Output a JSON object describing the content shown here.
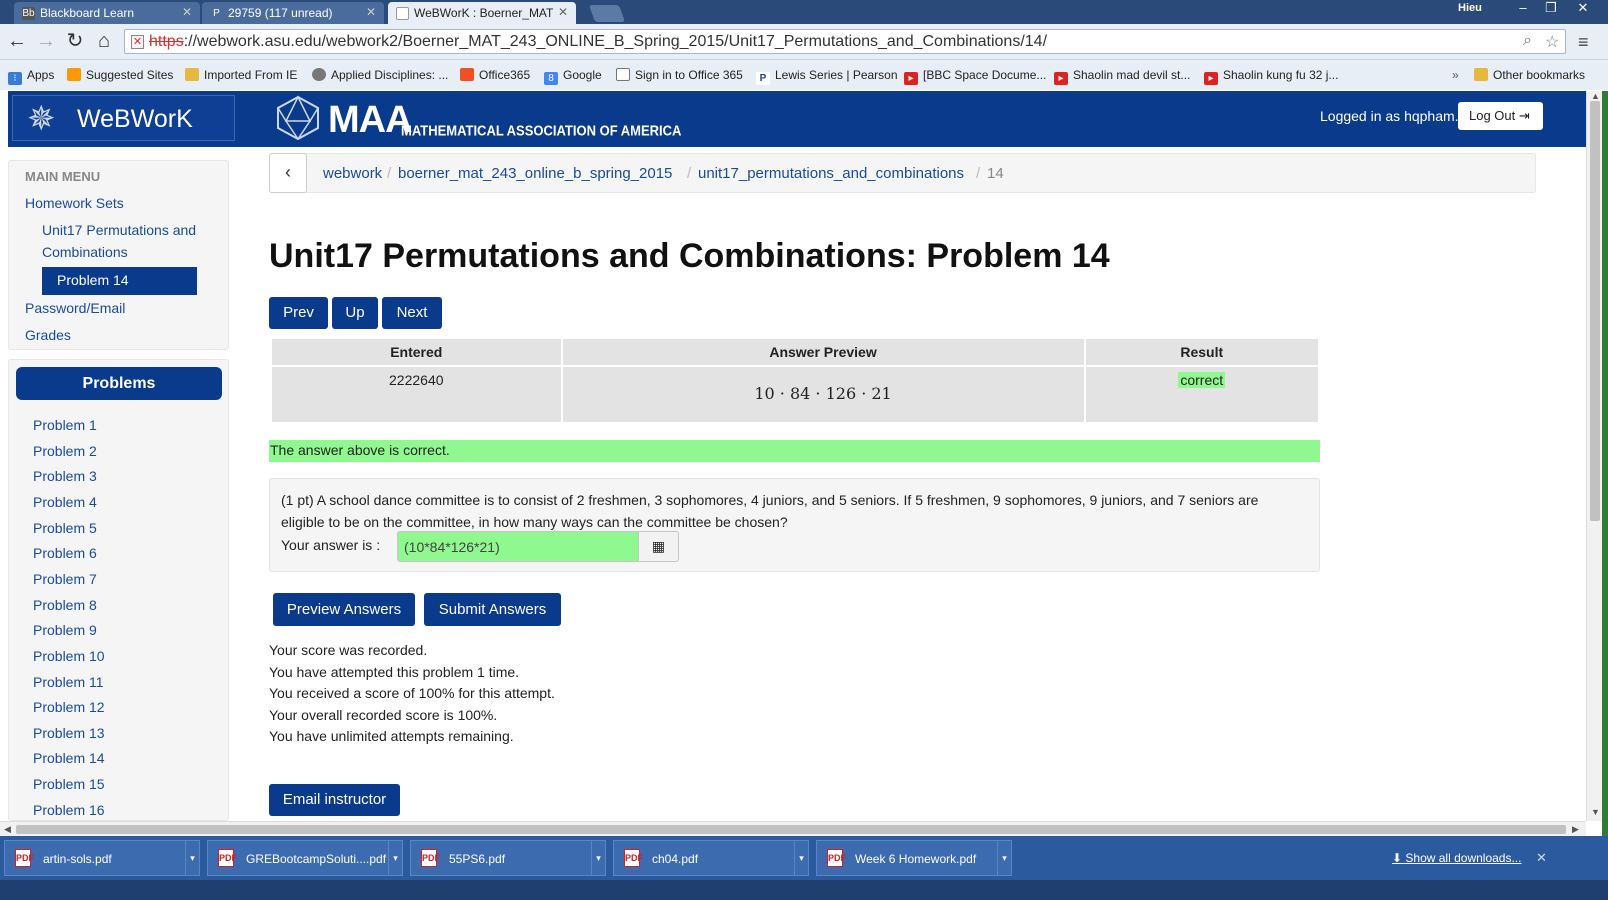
{
  "browser": {
    "tabs": [
      {
        "title": "Blackboard Learn",
        "icon": "Bb"
      },
      {
        "title": "29759 (117 unread)",
        "icon": "P"
      },
      {
        "title": "WeBWorK : Boerner_MAT",
        "icon": "doc"
      }
    ],
    "user": "Hieu",
    "url_scheme": "https",
    "url_rest": "://webwork.asu.edu/webwork2/Boerner_MAT_243_ONLINE_B_Spring_2015/Unit17_Permutations_and_Combinations/14/",
    "bookmarks": [
      {
        "label": "Apps",
        "icon": "grid"
      },
      {
        "label": "Suggested Sites",
        "icon": "orange"
      },
      {
        "label": "Imported From IE",
        "icon": "folder"
      },
      {
        "label": "Applied Disciplines: ...",
        "icon": "gray"
      },
      {
        "label": "Office365",
        "icon": "office"
      },
      {
        "label": "Google",
        "icon": "google"
      },
      {
        "label": "Sign in to Office 365",
        "icon": "doc"
      },
      {
        "label": "Lewis Series | Pearson",
        "icon": "p"
      },
      {
        "label": "[BBC Space Docume...",
        "icon": "red"
      },
      {
        "label": "Shaolin mad devil st...",
        "icon": "red"
      },
      {
        "label": "Shaolin kung fu 32 j...",
        "icon": "red"
      }
    ],
    "bookmark_overflow": "»",
    "other_bookmarks": "Other bookmarks"
  },
  "header": {
    "app_title": "WeBWorK",
    "maa_big": "MAA",
    "maa_small": "MATHEMATICAL ASSOCIATION OF AMERICA",
    "logged_in": "Logged in as hqpham.",
    "logout": "Log Out"
  },
  "sidebar": {
    "main_menu": "MAIN MENU",
    "homework_sets": "Homework Sets",
    "set_line1": "Unit17 Permutations and",
    "set_line2": "Combinations",
    "active_problem": "Problem 14",
    "password_email": "Password/Email",
    "grades": "Grades",
    "problems_header": "Problems",
    "problems": [
      "Problem 1",
      "Problem 2",
      "Problem 3",
      "Problem 4",
      "Problem 5",
      "Problem 6",
      "Problem 7",
      "Problem 8",
      "Problem 9",
      "Problem 10",
      "Problem 11",
      "Problem 12",
      "Problem 13",
      "Problem 14",
      "Problem 15",
      "Problem 16"
    ]
  },
  "breadcrumb": {
    "items": [
      "webwork",
      "boerner_mat_243_online_b_spring_2015",
      "unit17_permutations_and_combinations"
    ],
    "current": "14",
    "separator": "/"
  },
  "page_title": "Unit17 Permutations and Combinations: Problem 14",
  "nav": {
    "prev": "Prev",
    "up": "Up",
    "next": "Next"
  },
  "results": {
    "headers": [
      "Entered",
      "Answer Preview",
      "Result"
    ],
    "entered": "2222640",
    "preview": "10 · 84 · 126 · 21",
    "result": "correct"
  },
  "status_message": "The answer above is correct.",
  "problem": {
    "text": "(1 pt) A school dance committee is to consist of 2 freshmen, 3 sophomores, 4 juniors, and 5 seniors. If 5 freshmen, 9 sophomores, 9 juniors, and 7 seniors are eligible to be on the committee, in how many ways can the committee be chosen?",
    "answer_label": "Your answer is :",
    "answer_value": "(10*84*126*21)"
  },
  "actions": {
    "preview": "Preview Answers",
    "submit": "Submit Answers"
  },
  "score_lines": [
    "Your score was recorded.",
    "You have attempted this problem 1 time.",
    "You received a score of 100% for this attempt.",
    "Your overall recorded score is 100%.",
    "You have unlimited attempts remaining."
  ],
  "email_instructor": "Email instructor",
  "downloads": {
    "files": [
      "artin-sols.pdf",
      "GREBootcampSoluti....pdf",
      "55PS6.pdf",
      "ch04.pdf",
      "Week 6 Homework.pdf"
    ],
    "show_all": "Show all downloads..."
  },
  "colors": {
    "webwork_blue": "#0a3a8c",
    "correct_green": "#8ff88f",
    "link_blue": "#1a4b9a"
  }
}
